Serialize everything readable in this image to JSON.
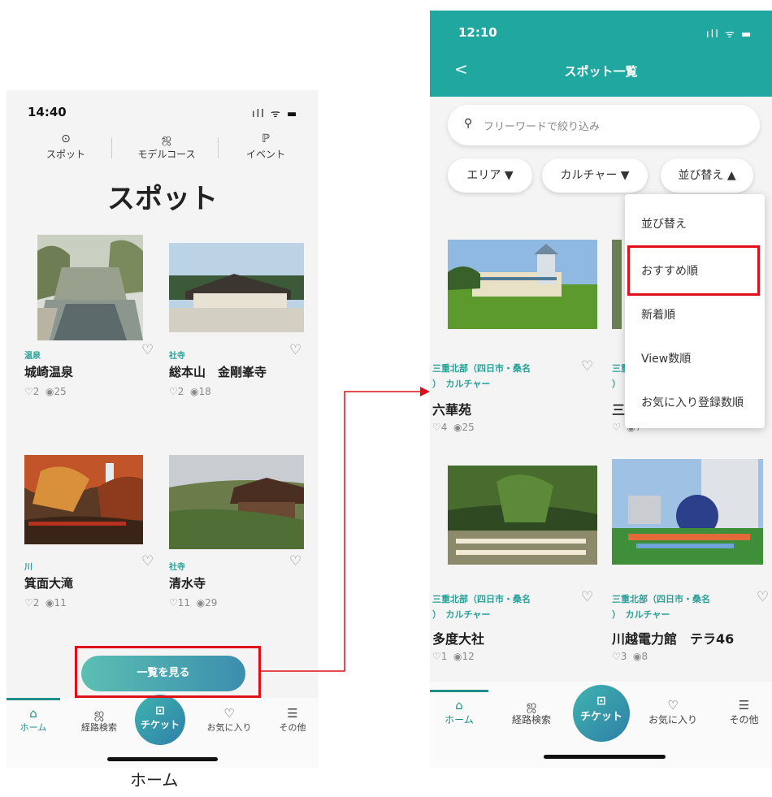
{
  "caption": "ホーム",
  "left_screen": {
    "status_bar": {
      "time": "14:40",
      "icons": "ıll ᯤ ▬"
    },
    "top_nav": [
      {
        "label": "スポット",
        "icon": "map-pin-icon",
        "glyph": "⊙"
      },
      {
        "label": "モデルコース",
        "icon": "route-icon",
        "glyph": "ஜ"
      },
      {
        "label": "イベント",
        "icon": "flag-icon",
        "glyph": "ℙ"
      }
    ],
    "title": "スポット",
    "cards": [
      {
        "category": "温泉",
        "title": "城崎温泉",
        "likes": "♡2",
        "views": "◉25"
      },
      {
        "category": "社寺",
        "title": "総本山　金剛峯寺",
        "likes": "♡2",
        "views": "◉18"
      },
      {
        "category": "川",
        "title": "箕面大滝",
        "likes": "♡2",
        "views": "◉11"
      },
      {
        "category": "社寺",
        "title": "清水寺",
        "likes": "♡11",
        "views": "◉29"
      }
    ],
    "view_all_button": "一覧を見る",
    "tabs": [
      {
        "label": "ホーム",
        "icon": "home-icon",
        "glyph": "⌂"
      },
      {
        "label": "経路検索",
        "icon": "route-search-icon",
        "glyph": "ஜ"
      },
      {
        "label": "チケット",
        "icon": "ticket-icon",
        "glyph": "⊡"
      },
      {
        "label": "お気に入り",
        "icon": "heart-icon",
        "glyph": "♡"
      },
      {
        "label": "その他",
        "icon": "menu-icon",
        "glyph": "☰"
      }
    ]
  },
  "right_screen": {
    "status_bar": {
      "time": "12:10",
      "icons": "ıll ᯤ ▬"
    },
    "header": {
      "back": "<",
      "title": "スポット一覧"
    },
    "search": {
      "placeholder": "フリーワードで絞り込み"
    },
    "filters": [
      {
        "label": "エリア ▼"
      },
      {
        "label": "カルチャー ▼"
      },
      {
        "label": "並び替え ▲"
      }
    ],
    "sort_menu": {
      "items": [
        "並び替え",
        "おすすめ順",
        "新着順",
        "View数順",
        "お気に入り登録数順"
      ],
      "highlighted": "おすすめ順"
    },
    "cards": [
      {
        "region_line1": "三重北部（四日市・桑名",
        "region_line2": "）　カルチャー",
        "title": "六華苑",
        "likes": "♡4",
        "views": "◉25"
      },
      {
        "region_line1": "三重",
        "region_line2": "）",
        "title": "三",
        "likes": "♡",
        "views": "◉7"
      },
      {
        "region_line1": "三重北部（四日市・桑名",
        "region_line2": "）　カルチャー",
        "title": "多度大社",
        "likes": "♡1",
        "views": "◉12"
      },
      {
        "region_line1": "三重北部（四日市・桑名",
        "region_line2": "）　カルチャー",
        "title": "川越電力館　テラ46",
        "likes": "♡3",
        "views": "◉8"
      }
    ],
    "tabs": [
      {
        "label": "ホーム",
        "icon": "home-icon",
        "glyph": "⌂"
      },
      {
        "label": "経路検索",
        "icon": "route-search-icon",
        "glyph": "ஜ"
      },
      {
        "label": "チケット",
        "icon": "ticket-icon",
        "glyph": "⊡"
      },
      {
        "label": "お気に入り",
        "icon": "heart-icon",
        "glyph": "♡"
      },
      {
        "label": "その他",
        "icon": "menu-icon",
        "glyph": "☰"
      }
    ]
  },
  "colors": {
    "teal": "#20a7a0",
    "highlight_red": "#e0101a",
    "arrow_red": "#e0101a"
  }
}
